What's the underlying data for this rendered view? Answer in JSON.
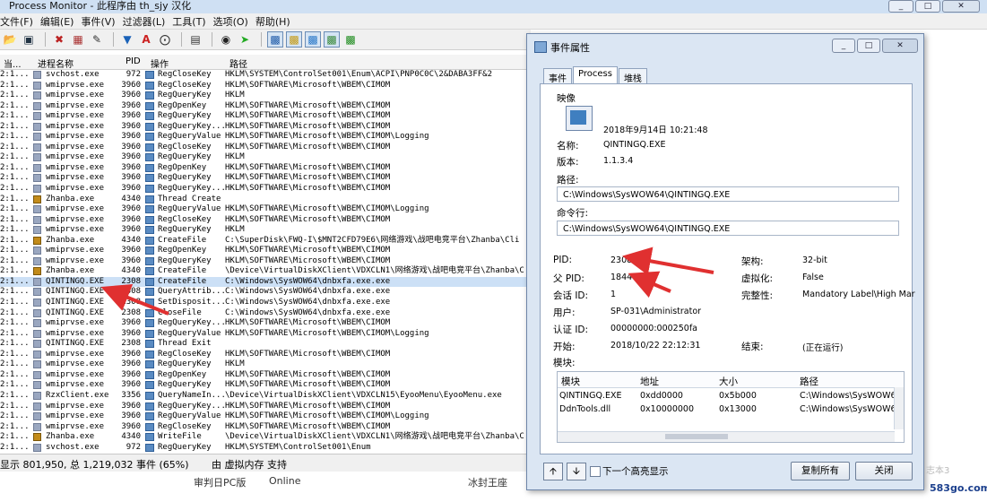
{
  "main": {
    "title": "Process Monitor - 此程序由 th_sjy 汉化",
    "win_buttons": {
      "min": "_",
      "max": "□",
      "close": "✕"
    },
    "menu": [
      "文件(F)",
      "编辑(E)",
      "事件(V)",
      "过滤器(L)",
      "工具(T)",
      "选项(O)",
      "帮助(H)"
    ],
    "toolbar_icons": [
      "open-icon",
      "save-icon",
      "magnify-icon",
      "autoscroll-icon",
      "clear-icon",
      "filter-icon",
      "highlight-icon",
      "target-icon",
      "jump-icon",
      "find-icon",
      "bookmark-icon",
      "registry-activity-icon",
      "file-activity-icon",
      "network-activity-icon",
      "process-activity-icon",
      "profiling-icon"
    ],
    "columns": {
      "time": "当...",
      "process": "进程名称",
      "pid": "PID",
      "operation": "操作",
      "path": "路径"
    },
    "rows": [
      {
        "t": "2:1...",
        "name": "svchost.exe",
        "pid": "972",
        "op": "RegCloseKey",
        "path": "HKLM\\SYSTEM\\ControlSet001\\Enum\\ACPI\\PNP0C0C\\2&DABA3FF&2",
        "z": false
      },
      {
        "t": "2:1...",
        "name": "wmiprvse.exe",
        "pid": "3960",
        "op": "RegCloseKey",
        "path": "HKLM\\SOFTWARE\\Microsoft\\WBEM\\CIMOM",
        "z": false
      },
      {
        "t": "2:1...",
        "name": "wmiprvse.exe",
        "pid": "3960",
        "op": "RegQueryKey",
        "path": "HKLM",
        "z": false
      },
      {
        "t": "2:1...",
        "name": "wmiprvse.exe",
        "pid": "3960",
        "op": "RegOpenKey",
        "path": "HKLM\\SOFTWARE\\Microsoft\\WBEM\\CIMOM",
        "z": false
      },
      {
        "t": "2:1...",
        "name": "wmiprvse.exe",
        "pid": "3960",
        "op": "RegQueryKey",
        "path": "HKLM\\SOFTWARE\\Microsoft\\WBEM\\CIMOM",
        "z": false
      },
      {
        "t": "2:1...",
        "name": "wmiprvse.exe",
        "pid": "3960",
        "op": "RegQueryKey...",
        "path": "HKLM\\SOFTWARE\\Microsoft\\WBEM\\CIMOM",
        "z": false
      },
      {
        "t": "2:1...",
        "name": "wmiprvse.exe",
        "pid": "3960",
        "op": "RegQueryValue",
        "path": "HKLM\\SOFTWARE\\Microsoft\\WBEM\\CIMOM\\Logging",
        "z": false
      },
      {
        "t": "2:1...",
        "name": "wmiprvse.exe",
        "pid": "3960",
        "op": "RegCloseKey",
        "path": "HKLM\\SOFTWARE\\Microsoft\\WBEM\\CIMOM",
        "z": false
      },
      {
        "t": "2:1...",
        "name": "wmiprvse.exe",
        "pid": "3960",
        "op": "RegQueryKey",
        "path": "HKLM",
        "z": false
      },
      {
        "t": "2:1...",
        "name": "wmiprvse.exe",
        "pid": "3960",
        "op": "RegOpenKey",
        "path": "HKLM\\SOFTWARE\\Microsoft\\WBEM\\CIMOM",
        "z": false
      },
      {
        "t": "2:1...",
        "name": "wmiprvse.exe",
        "pid": "3960",
        "op": "RegQueryKey",
        "path": "HKLM\\SOFTWARE\\Microsoft\\WBEM\\CIMOM",
        "z": false
      },
      {
        "t": "2:1...",
        "name": "wmiprvse.exe",
        "pid": "3960",
        "op": "RegQueryKey...",
        "path": "HKLM\\SOFTWARE\\Microsoft\\WBEM\\CIMOM",
        "z": false
      },
      {
        "t": "2:1...",
        "name": "Zhanba.exe",
        "pid": "4340",
        "op": "Thread Create",
        "path": "",
        "z": true
      },
      {
        "t": "2:1...",
        "name": "wmiprvse.exe",
        "pid": "3960",
        "op": "RegQueryValue",
        "path": "HKLM\\SOFTWARE\\Microsoft\\WBEM\\CIMOM\\Logging",
        "z": false
      },
      {
        "t": "2:1...",
        "name": "wmiprvse.exe",
        "pid": "3960",
        "op": "RegCloseKey",
        "path": "HKLM\\SOFTWARE\\Microsoft\\WBEM\\CIMOM",
        "z": false
      },
      {
        "t": "2:1...",
        "name": "wmiprvse.exe",
        "pid": "3960",
        "op": "RegQueryKey",
        "path": "HKLM",
        "z": false
      },
      {
        "t": "2:1...",
        "name": "Zhanba.exe",
        "pid": "4340",
        "op": "CreateFile",
        "path": "C:\\SuperDisk\\FWQ-I\\$MNT2CFD79E6\\网络游戏\\战吧电竞平台\\Zhanba\\Cli",
        "z": true
      },
      {
        "t": "2:1...",
        "name": "wmiprvse.exe",
        "pid": "3960",
        "op": "RegOpenKey",
        "path": "HKLM\\SOFTWARE\\Microsoft\\WBEM\\CIMOM",
        "z": false
      },
      {
        "t": "2:1...",
        "name": "wmiprvse.exe",
        "pid": "3960",
        "op": "RegQueryKey",
        "path": "HKLM\\SOFTWARE\\Microsoft\\WBEM\\CIMOM",
        "z": false
      },
      {
        "t": "2:1...",
        "name": "Zhanba.exe",
        "pid": "4340",
        "op": "CreateFile",
        "path": "\\Device\\VirtualDiskXClient\\VDXCLN1\\网络游戏\\战吧电竞平台\\Zhanba\\C",
        "z": true
      },
      {
        "t": "2:1...",
        "name": "QINTINGQ.EXE",
        "pid": "2308",
        "op": "CreateFile",
        "path": "C:\\Windows\\SysWOW64\\dnbxfa.exe.exe",
        "z": false,
        "sel": true
      },
      {
        "t": "2:1...",
        "name": "QINTINGQ.EXE",
        "pid": "2308",
        "op": "QueryAttrib...",
        "path": "C:\\Windows\\SysWOW64\\dnbxfa.exe.exe",
        "z": false
      },
      {
        "t": "2:1...",
        "name": "QINTINGQ.EXE",
        "pid": "2308",
        "op": "SetDisposit...",
        "path": "C:\\Windows\\SysWOW64\\dnbxfa.exe.exe",
        "z": false
      },
      {
        "t": "2:1...",
        "name": "QINTINGQ.EXE",
        "pid": "2308",
        "op": "CloseFile",
        "path": "C:\\Windows\\SysWOW64\\dnbxfa.exe.exe",
        "z": false
      },
      {
        "t": "2:1...",
        "name": "wmiprvse.exe",
        "pid": "3960",
        "op": "RegQueryKey...",
        "path": "HKLM\\SOFTWARE\\Microsoft\\WBEM\\CIMOM",
        "z": false
      },
      {
        "t": "2:1...",
        "name": "wmiprvse.exe",
        "pid": "3960",
        "op": "RegQueryValue",
        "path": "HKLM\\SOFTWARE\\Microsoft\\WBEM\\CIMOM\\Logging",
        "z": false
      },
      {
        "t": "2:1...",
        "name": "QINTINGQ.EXE",
        "pid": "2308",
        "op": "Thread Exit",
        "path": "",
        "z": false
      },
      {
        "t": "2:1...",
        "name": "wmiprvse.exe",
        "pid": "3960",
        "op": "RegCloseKey",
        "path": "HKLM\\SOFTWARE\\Microsoft\\WBEM\\CIMOM",
        "z": false
      },
      {
        "t": "2:1...",
        "name": "wmiprvse.exe",
        "pid": "3960",
        "op": "RegQueryKey",
        "path": "HKLM",
        "z": false
      },
      {
        "t": "2:1...",
        "name": "wmiprvse.exe",
        "pid": "3960",
        "op": "RegOpenKey",
        "path": "HKLM\\SOFTWARE\\Microsoft\\WBEM\\CIMOM",
        "z": false
      },
      {
        "t": "2:1...",
        "name": "wmiprvse.exe",
        "pid": "3960",
        "op": "RegQueryKey",
        "path": "HKLM\\SOFTWARE\\Microsoft\\WBEM\\CIMOM",
        "z": false
      },
      {
        "t": "2:1...",
        "name": "RzxClient.exe",
        "pid": "3356",
        "op": "QueryNameIn...",
        "path": "\\Device\\VirtualDiskXClient\\VDXCLN15\\EyooMenu\\EyooMenu.exe",
        "z": false
      },
      {
        "t": "2:1...",
        "name": "wmiprvse.exe",
        "pid": "3960",
        "op": "RegQueryKey...",
        "path": "HKLM\\SOFTWARE\\Microsoft\\WBEM\\CIMOM",
        "z": false
      },
      {
        "t": "2:1...",
        "name": "wmiprvse.exe",
        "pid": "3960",
        "op": "RegQueryValue",
        "path": "HKLM\\SOFTWARE\\Microsoft\\WBEM\\CIMOM\\Logging",
        "z": false
      },
      {
        "t": "2:1...",
        "name": "wmiprvse.exe",
        "pid": "3960",
        "op": "RegCloseKey",
        "path": "HKLM\\SOFTWARE\\Microsoft\\WBEM\\CIMOM",
        "z": false
      },
      {
        "t": "2:1...",
        "name": "Zhanba.exe",
        "pid": "4340",
        "op": "WriteFile",
        "path": "\\Device\\VirtualDiskXClient\\VDXCLN1\\网络游戏\\战吧电竞平台\\Zhanba\\C",
        "z": true
      },
      {
        "t": "2:1...",
        "name": "svchost.exe",
        "pid": "972",
        "op": "RegQueryKey",
        "path": "HKLM\\SYSTEM\\ControlSet001\\Enum",
        "z": false
      }
    ],
    "status": {
      "events": "显示 801,950, 总 1,219,032 事件 (65%)",
      "backing": "由 虚拟内存 支持"
    }
  },
  "taskbar": {
    "item1": "审判日PC版",
    "item2": "Online",
    "item3": "冰封王座"
  },
  "dialog": {
    "title": "事件属性",
    "tabs": [
      "事件",
      "Process",
      "堆栈"
    ],
    "image_label": "映像",
    "timestamp": "2018年9月14日 10:21:48",
    "name_label": "名称:",
    "name": "QINTINGQ.EXE",
    "version_label": "版本:",
    "version": "1.1.3.4",
    "path_label": "路径:",
    "path": "C:\\Windows\\SysWOW64\\QINTINGQ.EXE",
    "cmdline_label": "命令行:",
    "cmdline": "C:\\Windows\\SysWOW64\\QINTINGQ.EXE",
    "pid_label": "PID:",
    "pid": "2308",
    "arch_label": "架构:",
    "arch": "32-bit",
    "ppid_label": "父 PID:",
    "ppid": "1844",
    "virt_label": "虚拟化:",
    "virt": "False",
    "session_label": "会话 ID:",
    "session": "1",
    "integrity_label": "完整性:",
    "integrity": "Mandatory Label\\High Mar",
    "user_label": "用户:",
    "user": "SP-031\\Administrator",
    "auth_label": "认证 ID:",
    "auth": "00000000:000250fa",
    "start_label": "开始:",
    "start": "2018/10/22 22:12:31",
    "end_label": "结束:",
    "end": "(正在运行)",
    "modules_label": "模块:",
    "mod_cols": {
      "module": "模块",
      "address": "地址",
      "size": "大小",
      "path": "路径"
    },
    "modules": [
      {
        "module": "QINTINGQ.EXE",
        "address": "0xdd0000",
        "size": "0x5b000",
        "path": "C:\\Windows\\SysWOW6"
      },
      {
        "module": "DdnTools.dll",
        "address": "0x10000000",
        "size": "0x13000",
        "path": "C:\\Windows\\SysWOW6"
      }
    ],
    "next_highlight": "下一个高亮显示",
    "copy_all": "复制所有",
    "close": "关闭"
  },
  "watermark": "583go.com",
  "watermark_faint": "志本3",
  "accent_color": "#e03030"
}
